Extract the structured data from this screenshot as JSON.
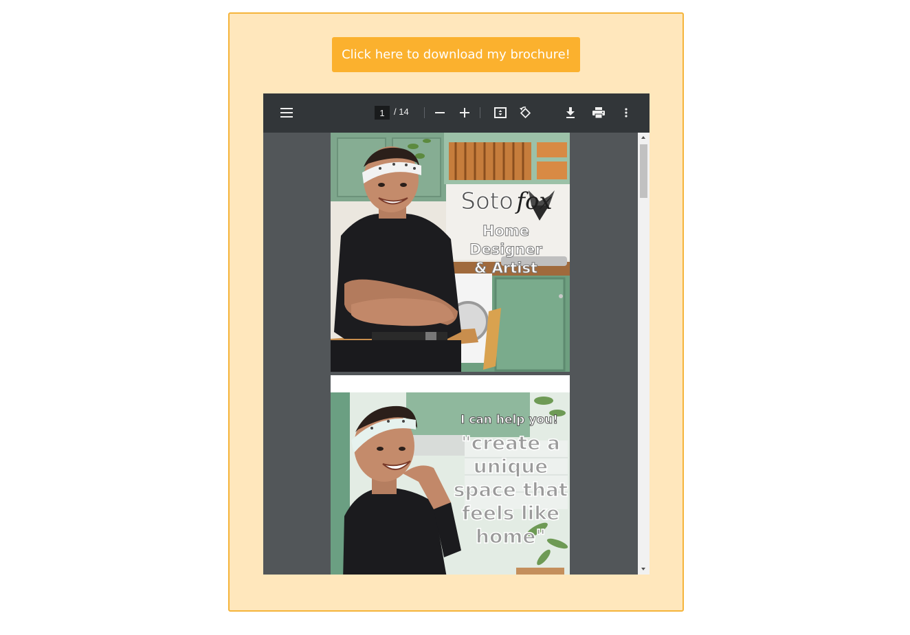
{
  "download_button": {
    "label": "Click here to download my brochure!"
  },
  "pdf_viewer": {
    "toolbar": {
      "current_page": "1",
      "page_total": "/ 14",
      "icons": {
        "menu": "menu-icon",
        "zoom_out": "minus-icon",
        "zoom_in": "plus-icon",
        "fit": "fit-to-page-icon",
        "rotate": "rotate-icon",
        "download": "download-icon",
        "print": "print-icon",
        "more": "more-vert-icon"
      }
    },
    "pages": [
      {
        "brand": "Soto",
        "brand_accent": "fox",
        "title_line1": "Home Designer",
        "title_line2": "& Artist"
      },
      {
        "lead": "I can help you!",
        "quote_line1": "\"create a",
        "quote_line2": "unique",
        "quote_line3": "space that",
        "quote_line4": "feels like",
        "quote_line5": "home\""
      }
    ]
  },
  "colors": {
    "card_bg": "#ffe7bc",
    "card_border": "#f5b43a",
    "button_bg": "#fbb12e",
    "toolbar_bg": "#323639",
    "viewer_bg": "#525659"
  }
}
